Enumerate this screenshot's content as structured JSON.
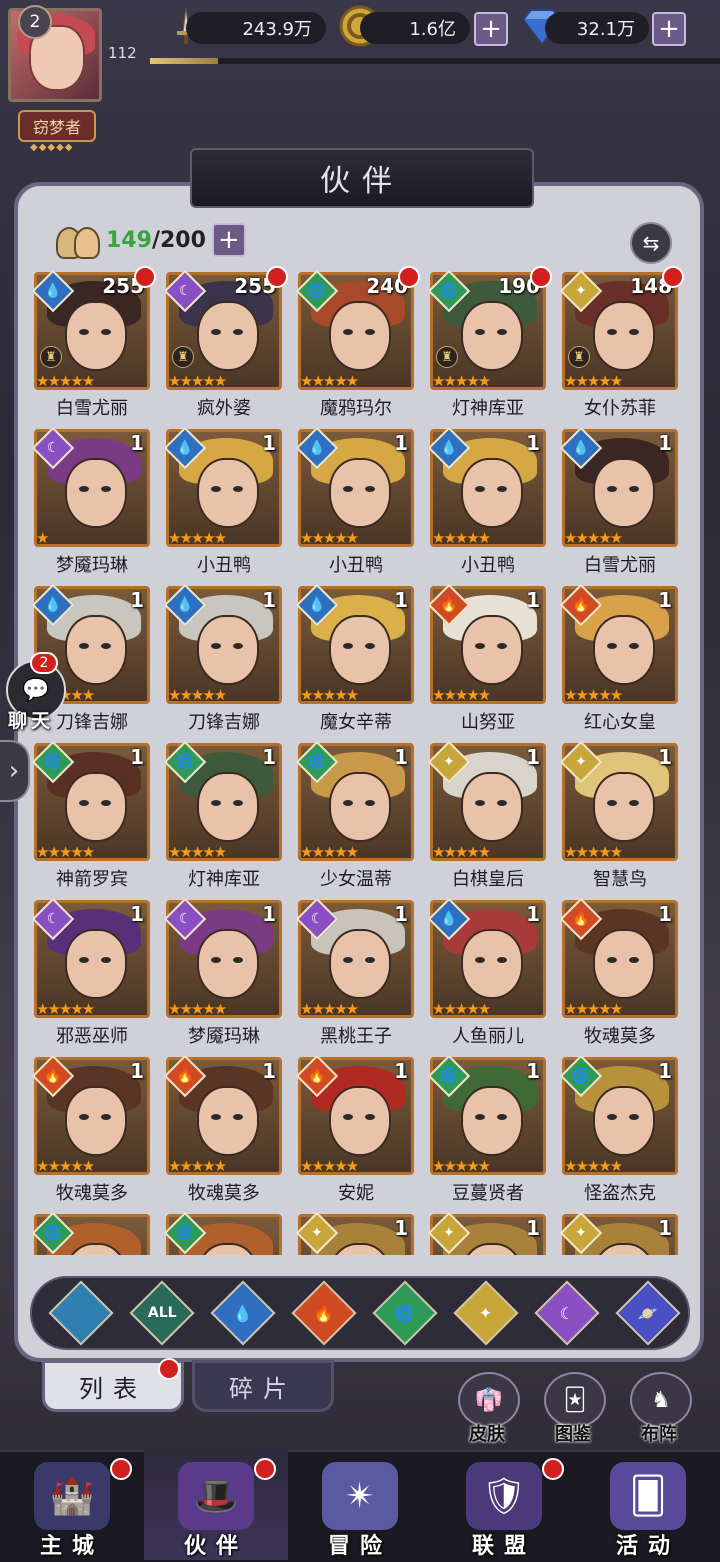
{
  "player": {
    "avatar_level": "2",
    "level": "112",
    "xp_fraction": 0.12,
    "title": "窃梦者",
    "title_stars": "◆◆◆◆◆"
  },
  "resources": [
    {
      "icon": "sword-icon",
      "value": "243.9万"
    },
    {
      "icon": "gold-coin-icon",
      "value": "1.6亿"
    },
    {
      "icon": "diamond-icon",
      "value": "32.1万"
    }
  ],
  "panel": {
    "title": "伙伴",
    "count_current": "149",
    "count_max": "/200"
  },
  "colors": {
    "water": "#2f6fbf",
    "dark": "#8a4fc3",
    "fire": "#d04a23",
    "wind": "#2f9a58",
    "light": "#c9a63a",
    "star": "#f29b1f",
    "frame": "#b5712c",
    "badge_red": "#d41f1f"
  },
  "partners": [
    {
      "name": "白雪尤丽",
      "level": "255",
      "element": "water",
      "stars": 5,
      "dot": true,
      "chess": true,
      "hair": "#3a2622"
    },
    {
      "name": "疯外婆",
      "level": "255",
      "element": "dark",
      "stars": 5,
      "dot": true,
      "chess": true,
      "hair": "#3a344a"
    },
    {
      "name": "魔鸦玛尔",
      "level": "240",
      "element": "wind",
      "stars": 5,
      "dot": true,
      "chess": false,
      "hair": "#a64a2a"
    },
    {
      "name": "灯神库亚",
      "level": "190",
      "element": "wind",
      "stars": 5,
      "dot": true,
      "chess": true,
      "hair": "#3d5a3a"
    },
    {
      "name": "女仆苏菲",
      "level": "148",
      "element": "light",
      "stars": 5,
      "dot": true,
      "chess": true,
      "hair": "#6a2f28"
    },
    {
      "name": "梦魇玛琳",
      "level": "1",
      "element": "dark",
      "stars": 1,
      "dot": false,
      "chess": false,
      "hair": "#7a3a86"
    },
    {
      "name": "小丑鸭",
      "level": "1",
      "element": "water",
      "stars": 5,
      "dot": false,
      "chess": false,
      "hair": "#d6a845"
    },
    {
      "name": "小丑鸭",
      "level": "1",
      "element": "water",
      "stars": 5,
      "dot": false,
      "chess": false,
      "hair": "#d6a845"
    },
    {
      "name": "小丑鸭",
      "level": "1",
      "element": "water",
      "stars": 5,
      "dot": false,
      "chess": false,
      "hair": "#d6a845"
    },
    {
      "name": "白雪尤丽",
      "level": "1",
      "element": "water",
      "stars": 5,
      "dot": false,
      "chess": false,
      "hair": "#3a2622"
    },
    {
      "name": "刀锋吉娜",
      "level": "1",
      "element": "water",
      "stars": 5,
      "dot": false,
      "chess": false,
      "hair": "#c9c6c0"
    },
    {
      "name": "刀锋吉娜",
      "level": "1",
      "element": "water",
      "stars": 5,
      "dot": false,
      "chess": false,
      "hair": "#c9c6c0"
    },
    {
      "name": "魔女辛蒂",
      "level": "1",
      "element": "water",
      "stars": 5,
      "dot": false,
      "chess": false,
      "hair": "#d9b04a"
    },
    {
      "name": "山努亚",
      "level": "1",
      "element": "fire",
      "stars": 5,
      "dot": false,
      "chess": false,
      "hair": "#e8e2d6"
    },
    {
      "name": "红心女皇",
      "level": "1",
      "element": "fire",
      "stars": 5,
      "dot": false,
      "chess": false,
      "hair": "#d9a24a"
    },
    {
      "name": "神箭罗宾",
      "level": "1",
      "element": "wind",
      "stars": 5,
      "dot": false,
      "chess": false,
      "hair": "#5a2f24"
    },
    {
      "name": "灯神库亚",
      "level": "1",
      "element": "wind",
      "stars": 5,
      "dot": false,
      "chess": false,
      "hair": "#3d5a3a"
    },
    {
      "name": "少女温蒂",
      "level": "1",
      "element": "wind",
      "stars": 5,
      "dot": false,
      "chess": false,
      "hair": "#c99a4a"
    },
    {
      "name": "白棋皇后",
      "level": "1",
      "element": "light",
      "stars": 5,
      "dot": false,
      "chess": false,
      "hair": "#d8d4cc"
    },
    {
      "name": "智慧鸟",
      "level": "1",
      "element": "light",
      "stars": 5,
      "dot": false,
      "chess": false,
      "hair": "#e0c47a"
    },
    {
      "name": "邪恶巫师",
      "level": "1",
      "element": "dark",
      "stars": 5,
      "dot": false,
      "chess": false,
      "hair": "#5a2f7a"
    },
    {
      "name": "梦魇玛琳",
      "level": "1",
      "element": "dark",
      "stars": 5,
      "dot": false,
      "chess": false,
      "hair": "#7a3a86"
    },
    {
      "name": "黑桃王子",
      "level": "1",
      "element": "dark",
      "stars": 5,
      "dot": false,
      "chess": false,
      "hair": "#c8c4bc"
    },
    {
      "name": "人鱼丽儿",
      "level": "1",
      "element": "water",
      "stars": 5,
      "dot": false,
      "chess": false,
      "hair": "#a83a3a"
    },
    {
      "name": "牧魂莫多",
      "level": "1",
      "element": "fire",
      "stars": 5,
      "dot": false,
      "chess": false,
      "hair": "#5a3424"
    },
    {
      "name": "牧魂莫多",
      "level": "1",
      "element": "fire",
      "stars": 5,
      "dot": false,
      "chess": false,
      "hair": "#5a3424"
    },
    {
      "name": "牧魂莫多",
      "level": "1",
      "element": "fire",
      "stars": 5,
      "dot": false,
      "chess": false,
      "hair": "#5a3424"
    },
    {
      "name": "安妮",
      "level": "1",
      "element": "fire",
      "stars": 5,
      "dot": false,
      "chess": false,
      "hair": "#b02a22"
    },
    {
      "name": "豆蔓贤者",
      "level": "1",
      "element": "wind",
      "stars": 5,
      "dot": false,
      "chess": false,
      "hair": "#3f6a36"
    },
    {
      "name": "怪盗杰克",
      "level": "1",
      "element": "wind",
      "stars": 5,
      "dot": false,
      "chess": false,
      "hair": "#b8923a"
    },
    {
      "name": "",
      "level": "",
      "element": "wind",
      "stars": 0,
      "dot": false,
      "chess": false,
      "hair": "#b0602a"
    },
    {
      "name": "",
      "level": "",
      "element": "wind",
      "stars": 0,
      "dot": false,
      "chess": false,
      "hair": "#b0602a"
    },
    {
      "name": "",
      "level": "1",
      "element": "light",
      "stars": 0,
      "dot": false,
      "chess": false,
      "hair": "#a8823a"
    },
    {
      "name": "",
      "level": "1",
      "element": "light",
      "stars": 0,
      "dot": false,
      "chess": false,
      "hair": "#a8823a"
    },
    {
      "name": "",
      "level": "1",
      "element": "light",
      "stars": 0,
      "dot": false,
      "chess": false,
      "hair": "#a8823a"
    }
  ],
  "filters": [
    {
      "id": "neutral",
      "label": "",
      "color": "#2f7fb0"
    },
    {
      "id": "all",
      "label": "ALL",
      "color": "#2a6a5a"
    },
    {
      "id": "water",
      "label": "💧",
      "color": "#2f6fbf"
    },
    {
      "id": "fire",
      "label": "🔥",
      "color": "#d04a23"
    },
    {
      "id": "wind",
      "label": "🌀",
      "color": "#2f9a58"
    },
    {
      "id": "light",
      "label": "✦",
      "color": "#c9a63a"
    },
    {
      "id": "dark",
      "label": "☾",
      "color": "#8a4fc3"
    },
    {
      "id": "cosmic",
      "label": "🪐",
      "color": "#4a4fc3"
    }
  ],
  "tabs": {
    "list": "列表",
    "shards": "碎片"
  },
  "side_buttons": [
    {
      "label": "皮肤",
      "icon": "skin-icon"
    },
    {
      "label": "图鉴",
      "icon": "codex-icon"
    },
    {
      "label": "布阵",
      "icon": "formation-icon"
    }
  ],
  "chat": {
    "badge": "2",
    "label": "聊天"
  },
  "nav": [
    {
      "label": "主城",
      "icon": "castle-icon",
      "dot": true
    },
    {
      "label": "伙伴",
      "icon": "partner-hat-icon",
      "dot": true
    },
    {
      "label": "冒险",
      "icon": "compass-icon",
      "dot": false
    },
    {
      "label": "联盟",
      "icon": "shield-icon",
      "dot": true
    },
    {
      "label": "活动",
      "icon": "cards-icon",
      "dot": false
    }
  ]
}
